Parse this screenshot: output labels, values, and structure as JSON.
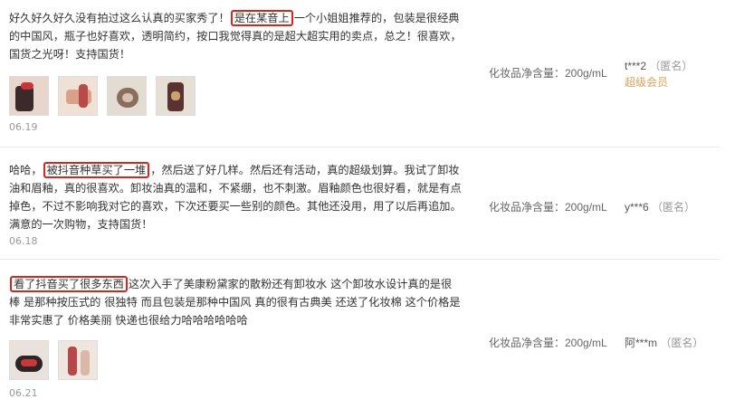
{
  "reviews": [
    {
      "text_before": "好久好久好久没有拍过这么认真的买家秀了！",
      "highlight": "是在某音上",
      "text_after": "一个小姐姐推荐的，包装是很经典的中国风，瓶子也好喜欢，透明简约，按口我觉得真的是超大超实用的卖点，总之！很喜欢，国货之光呀！支持国货！",
      "date": "06.19",
      "spec": "化妆品净含量：200g/mL",
      "user": "t***2",
      "anon": "（匿名）",
      "badge": "超级会员"
    },
    {
      "text_before": "哈哈，",
      "highlight": "被抖音种草买了一堆",
      "text_after": "，然后送了好几样。然后还有活动，真的超级划算。我试了卸妆油和眉釉，真的很喜欢。卸妆油真的温和，不紧绷，也不刺激。眉釉颜色也很好看，就是有点掉色，不过不影响我对它的喜欢，下次还要买一些别的颜色。其他还没用，用了以后再追加。满意的一次购物，支持国货！",
      "date": "06.18",
      "spec": "化妆品净含量：200g/mL",
      "user": "y***6",
      "anon": "（匿名）"
    },
    {
      "text_before": "",
      "highlight": "看了抖音买了很多东西",
      "text_after": "这次入手了美康粉黛家的散粉还有卸妆水 这个卸妆水设计真的是很棒 是那种按压式的 很独特 而且包装是那种中国风 真的很有古典美 还送了化妆棉 这个价格是非常实惠了 价格美丽 快递也很给力哈哈哈哈哈哈",
      "date": "06.21",
      "spec": "化妆品净含量：200g/mL",
      "user": "阿***m",
      "anon": "（匿名）"
    }
  ],
  "thumbnails": {
    "review1": [
      "photo-thumbnail-1",
      "photo-thumbnail-2",
      "photo-thumbnail-3",
      "photo-thumbnail-4"
    ],
    "review3": [
      "photo-thumbnail-1",
      "photo-thumbnail-2"
    ]
  },
  "colors": {
    "highlight_border": "#d9251c",
    "badge": "#e4a05b",
    "muted": "#999999"
  }
}
